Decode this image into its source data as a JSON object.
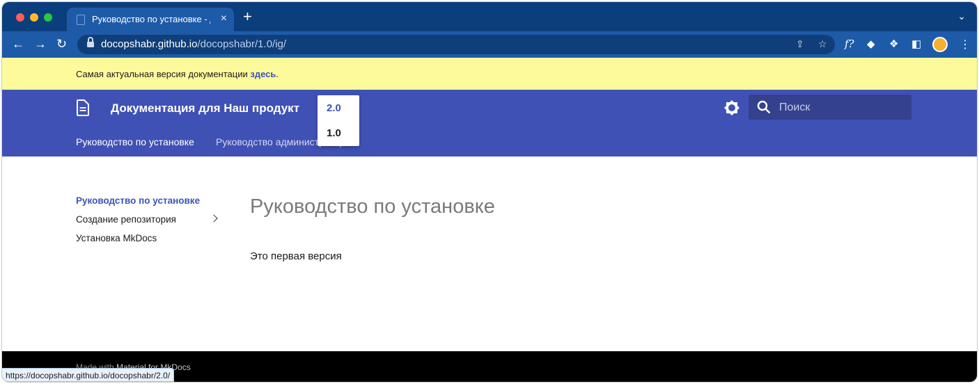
{
  "browser": {
    "tab_title": "Руководство по установке - Документация для Наш продукт",
    "tab_close": "×",
    "new_tab": "+",
    "url_host": "docopshabr.github.io",
    "url_path": "/docopshabr/1.0/ig/",
    "status_url": "https://docopshabr.github.io/docopshabr/2.0/"
  },
  "banner": {
    "text": "Самая актуальная версия документации ",
    "link": "здесь",
    "suffix": "."
  },
  "header": {
    "title": "Документация для Наш продукт",
    "search_placeholder": "Поиск",
    "tabs": [
      {
        "label": "Руководство по установке"
      },
      {
        "label": "Руководство администратора"
      }
    ]
  },
  "version_menu": {
    "items": [
      {
        "label": "2.0"
      },
      {
        "label": "1.0"
      }
    ]
  },
  "sidebar": {
    "items": [
      {
        "label": "Руководство по установке"
      },
      {
        "label": "Создание репозитория"
      },
      {
        "label": "Установка MkDocs"
      }
    ]
  },
  "main": {
    "title": "Руководство по установке",
    "text": "Это первая версия"
  },
  "footer": {
    "made_with": "Made with ",
    "link": "Material for MkDocs"
  },
  "colors": {
    "primary": "#4051b5",
    "banner": "#fdfa9c",
    "accent_link": "#3d54b8",
    "footer": "#000000"
  },
  "icons": [
    "document-icon",
    "lock-icon",
    "share-icon",
    "star-icon",
    "extension-icon",
    "sidepanel-icon",
    "palette-icon",
    "search-icon",
    "chevron-right-icon"
  ]
}
